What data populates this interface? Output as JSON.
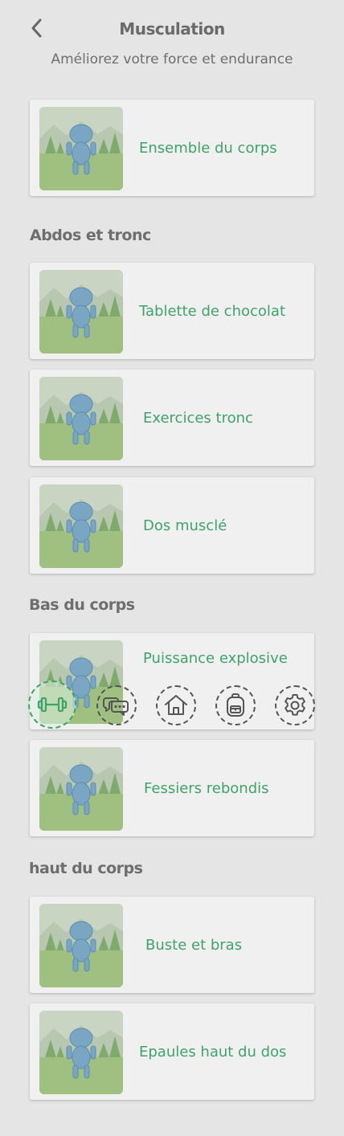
{
  "header": {
    "back_icon": "chevron-left-icon",
    "title": "Musculation",
    "subtitle": "Améliorez votre force et endurance"
  },
  "sections": [
    {
      "title": "",
      "items": [
        {
          "label": "Ensemble du corps"
        }
      ]
    },
    {
      "title": "Abdos et tronc",
      "items": [
        {
          "label": "Tablette de chocolat"
        },
        {
          "label": "Exercices tronc"
        },
        {
          "label": "Dos musclé"
        }
      ]
    },
    {
      "title": "Bas du corps",
      "items": [
        {
          "label": "Puissance explosive"
        },
        {
          "label": "Fessiers rebondis"
        }
      ]
    },
    {
      "title": "haut du corps",
      "items": [
        {
          "label": "Buste et bras"
        },
        {
          "label": "Epaules haut du dos"
        }
      ]
    }
  ],
  "nav": {
    "items": [
      {
        "icon": "dumbbell-icon",
        "active": true
      },
      {
        "icon": "chat-icon",
        "active": false
      },
      {
        "icon": "home-icon",
        "active": false
      },
      {
        "icon": "backpack-icon",
        "active": false
      },
      {
        "icon": "gear-icon",
        "active": false
      }
    ]
  },
  "colors": {
    "accent": "#3fa36b",
    "background": "#e5e5e5",
    "card": "#f0f0f0",
    "section_title": "#6e6e6e"
  }
}
